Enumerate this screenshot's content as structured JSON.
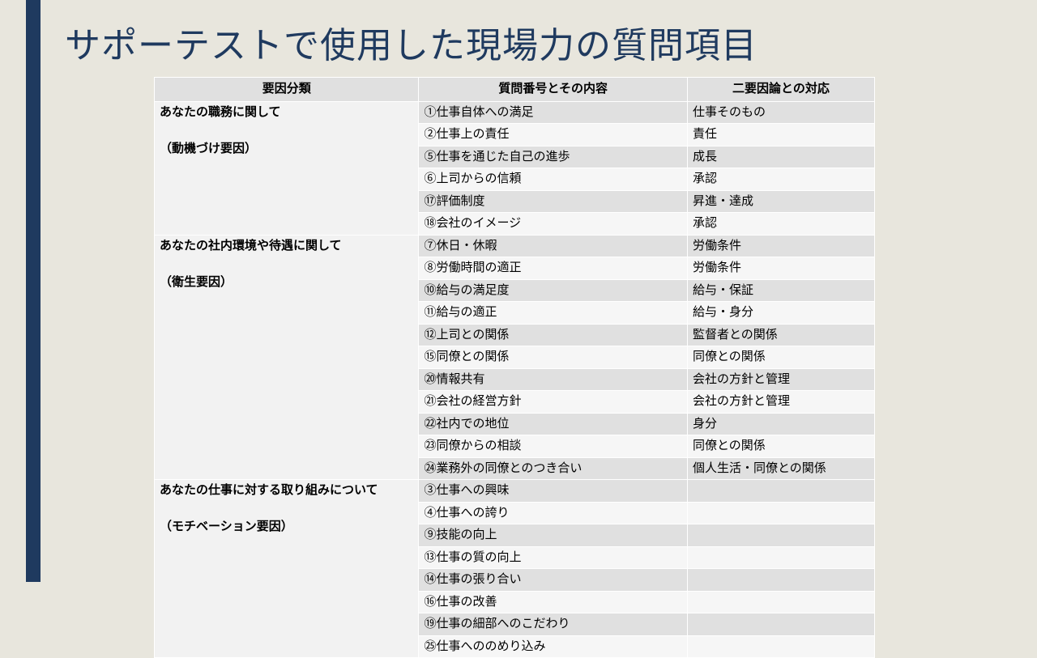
{
  "title": "サポーテストで使用した現場力の質問項目",
  "headers": [
    "要因分類",
    "質問番号とその内容",
    "二要因論との対応"
  ],
  "groups": [
    {
      "category_line1": "あなたの職務に関して",
      "category_line2": "（動機づけ要因）",
      "rows": [
        {
          "q": "①仕事自体への満足",
          "corr": "仕事そのもの"
        },
        {
          "q": "②仕事上の責任",
          "corr": "責任"
        },
        {
          "q": "⑤仕事を通じた自己の進歩",
          "corr": "成長"
        },
        {
          "q": "⑥上司からの信頼",
          "corr": "承認"
        },
        {
          "q": "⑰評価制度",
          "corr": "昇進・達成"
        },
        {
          "q": "⑱会社のイメージ",
          "corr": "承認"
        }
      ]
    },
    {
      "category_line1": "あなたの社内環境や待遇に関して",
      "category_line2": "（衛生要因）",
      "rows": [
        {
          "q": "⑦休日・休暇",
          "corr": "労働条件"
        },
        {
          "q": "⑧労働時間の適正",
          "corr": "労働条件"
        },
        {
          "q": "⑩給与の満足度",
          "corr": "給与・保証"
        },
        {
          "q": "⑪給与の適正",
          "corr": "給与・身分"
        },
        {
          "q": "⑫上司との関係",
          "corr": "監督者との関係"
        },
        {
          "q": "⑮同僚との関係",
          "corr": "同僚との関係"
        },
        {
          "q": "⑳情報共有",
          "corr": "会社の方針と管理"
        },
        {
          "q": "㉑会社の経営方針",
          "corr": "会社の方針と管理"
        },
        {
          "q": "㉒社内での地位",
          "corr": "身分"
        },
        {
          "q": "㉓同僚からの相談",
          "corr": "同僚との関係"
        },
        {
          "q": "㉔業務外の同僚とのつき合い",
          "corr": "個人生活・同僚との関係"
        }
      ]
    },
    {
      "category_line1": "あなたの仕事に対する取り組みについて",
      "category_line2": "（モチベーション要因）",
      "rows": [
        {
          "q": "③仕事への興味",
          "corr": ""
        },
        {
          "q": "④仕事への誇り",
          "corr": ""
        },
        {
          "q": "⑨技能の向上",
          "corr": ""
        },
        {
          "q": "⑬仕事の質の向上",
          "corr": ""
        },
        {
          "q": "⑭仕事の張り合い",
          "corr": ""
        },
        {
          "q": "⑯仕事の改善",
          "corr": ""
        },
        {
          "q": "⑲仕事の細部へのこだわり",
          "corr": ""
        },
        {
          "q": "㉕仕事へののめり込み",
          "corr": ""
        }
      ]
    }
  ]
}
